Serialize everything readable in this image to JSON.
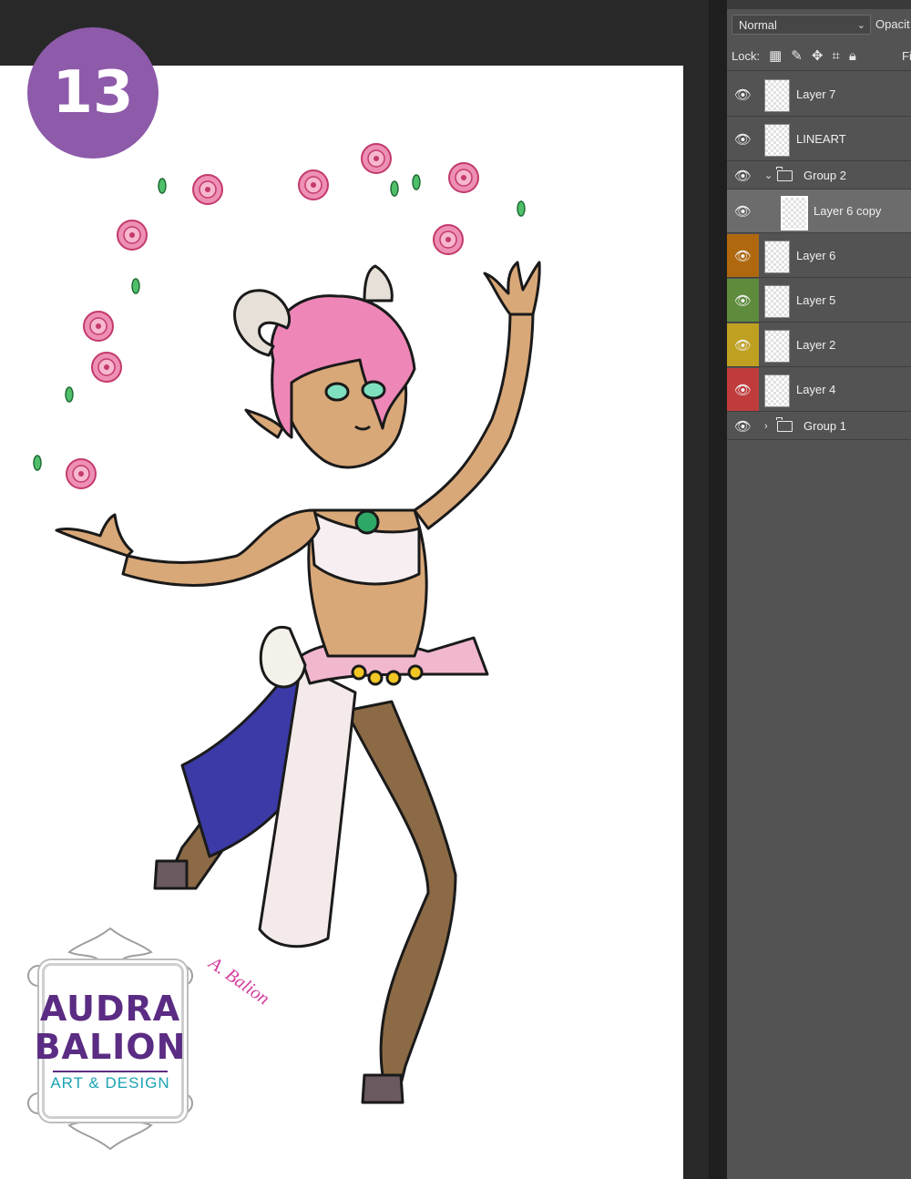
{
  "step": {
    "number": "13",
    "badge_color": "#8e5aaa"
  },
  "logo": {
    "line1": "AUDRA",
    "line2": "BALION",
    "tagline": "ART & DESIGN",
    "primary_color": "#5b2c83",
    "accent_color": "#1ba3b3"
  },
  "signature": {
    "text": "A. Balion"
  },
  "layers_panel": {
    "blend_mode": "Normal",
    "opacity_label": "Opacit",
    "lock_label": "Lock:",
    "fill_label": "Fi",
    "lock_icons": [
      "transparency-lock-icon",
      "brush-lock-icon",
      "move-lock-icon",
      "artboard-lock-icon",
      "padlock-icon"
    ],
    "layers": [
      {
        "name": "Layer 7",
        "kind": "layer",
        "visible": true,
        "color_tag": ""
      },
      {
        "name": "LINEART",
        "kind": "layer",
        "visible": true,
        "color_tag": ""
      },
      {
        "name": "Group 2",
        "kind": "group",
        "expanded": true,
        "visible": true,
        "color_tag": ""
      },
      {
        "name": "Layer 6 copy",
        "kind": "layer",
        "indented": true,
        "selected": true,
        "visible": true,
        "color_tag": ""
      },
      {
        "name": "Layer 6",
        "kind": "layer",
        "visible": true,
        "color_tag": "#b0680f"
      },
      {
        "name": "Layer 5",
        "kind": "layer",
        "visible": true,
        "color_tag": "#5f8c3c"
      },
      {
        "name": "Layer 2",
        "kind": "layer",
        "visible": true,
        "color_tag": "#c0a020"
      },
      {
        "name": "Layer 4",
        "kind": "layer",
        "visible": true,
        "color_tag": "#c03c3c"
      },
      {
        "name": "Group 1",
        "kind": "group",
        "expanded": false,
        "visible": true,
        "color_tag": ""
      }
    ]
  }
}
